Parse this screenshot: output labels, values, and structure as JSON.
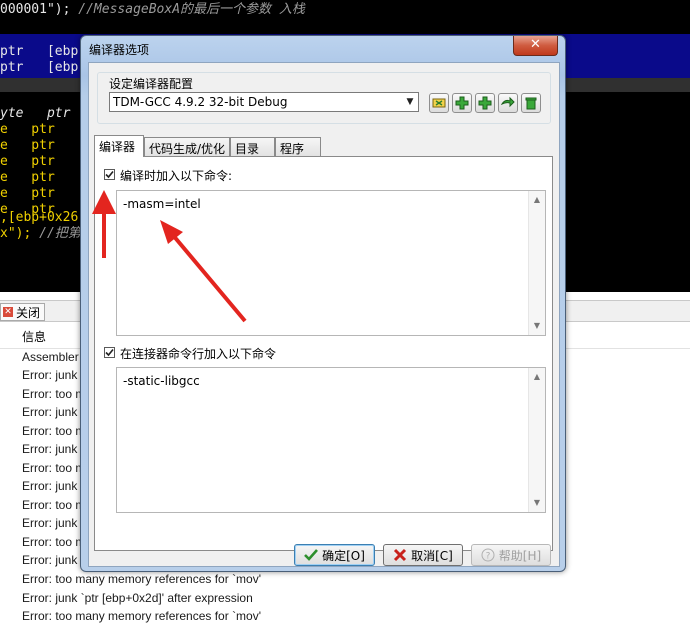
{
  "editor": {
    "line_top_code": "000001\");",
    "line_top_comment": "//MessageBoxA的最后一个参数 入栈",
    "sel_line1": "ptr   [ebp",
    "sel_line2": "ptr   [ebp",
    "yte_line": "yte   ptr",
    "ptr_lines": [
      "e   ptr",
      "e   ptr",
      "e   ptr",
      "e   ptr",
      "e   ptr",
      "e   ptr"
    ],
    "misc_line1": ",[ebp+0x26",
    "misc_line2_code": "x\");",
    "misc_line2_comment": "//把第"
  },
  "output_panel": {
    "close_tab_label": "关闭",
    "column_header": "信息",
    "rows": [
      "Assembler m",
      "Error: junk `",
      "Error: too m",
      "Error: junk `",
      "Error: too m",
      "Error: junk `",
      "Error: too m",
      "Error: junk `",
      "Error: too m",
      "Error: junk `",
      "Error: too m",
      "Error: junk `",
      "Error: too many memory references for `mov'",
      "Error: junk `ptr [ebp+0x2d]' after expression",
      "Error: too many memory references for `mov'"
    ]
  },
  "dialog": {
    "title": "编译器选项",
    "close_glyph": "✕",
    "config_group_label": "设定编译器配置",
    "config_selected": "TDM-GCC 4.9.2 32-bit Debug",
    "tabs": [
      "编译器",
      "代码生成/优化",
      "目录",
      "程序"
    ],
    "active_tab": 0,
    "compile_check_label": "编译时加入以下命令:",
    "compile_checked": true,
    "compile_commands": "-masm=intel",
    "linker_check_label": "在连接器命令行加入以下命令",
    "linker_checked": true,
    "linker_commands": "-static-libgcc",
    "buttons": {
      "ok": "确定[O]",
      "cancel": "取消[C]",
      "help": "帮助[H]"
    }
  },
  "colors": {
    "annotation_arrow": "#e3251f",
    "selection_band": "#0a0a8a",
    "code_yellow": "#f0d000"
  }
}
